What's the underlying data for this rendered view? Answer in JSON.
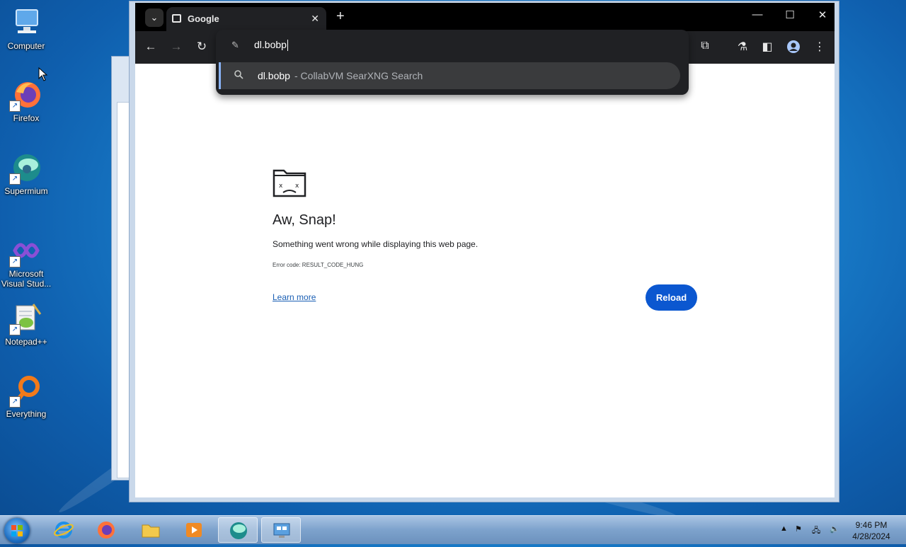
{
  "desktop": {
    "icons": [
      {
        "label": "Computer"
      },
      {
        "label": "Firefox"
      },
      {
        "label": "Supermium"
      },
      {
        "label": "Microsoft Visual Stud..."
      },
      {
        "label": "Notepad++"
      },
      {
        "label": "Everything"
      }
    ]
  },
  "browser": {
    "tab": {
      "title": "Google"
    },
    "tab_search_icon": "chevron-down-icon",
    "new_tab_label": "+",
    "omnibox": {
      "value": "dl.bobp",
      "suggestion": {
        "query": "dl.bobp",
        "suffix": "- CollabVM SearXNG Search"
      }
    },
    "error_page": {
      "title": "Aw, Snap!",
      "description": "Something went wrong while displaying this web page.",
      "error_code": "Error code: RESULT_CODE_HUNG",
      "learn_more": "Learn more",
      "reload": "Reload"
    },
    "colors": {
      "accent": "#0b57d0",
      "frame": "#202124"
    }
  },
  "taskbar": {
    "clock": {
      "time": "9:46 PM",
      "date": "4/28/2024"
    },
    "apps": [
      "Internet Explorer",
      "Firefox",
      "Windows Explorer",
      "Media Player",
      "Supermium",
      "Remote Desktop"
    ]
  }
}
